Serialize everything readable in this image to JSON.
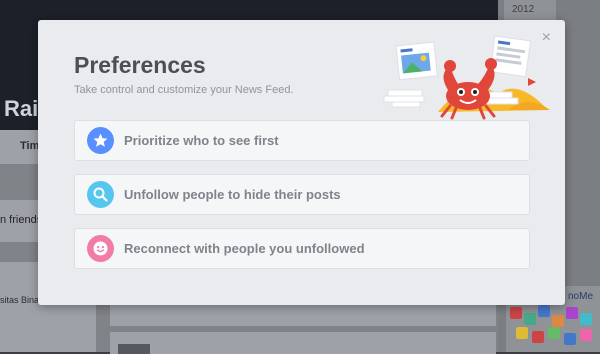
{
  "background": {
    "profile_name": "Rais",
    "tab_label": "Tim",
    "friends_text": "n friends",
    "university_text": "sitas Bina",
    "year_label": "2012",
    "ad_title": "noMe"
  },
  "modal": {
    "title": "Preferences",
    "subtitle": "Take control and customize your News Feed.",
    "close_label": "×",
    "options": [
      {
        "label": "Prioritize who to see first",
        "icon": "star-icon",
        "color": "#5890ff"
      },
      {
        "label": "Unfollow people to hide their posts",
        "icon": "search-icon",
        "color": "#55c6ee"
      },
      {
        "label": "Reconnect with people you unfollowed",
        "icon": "smiley-icon",
        "color": "#f27ba7"
      }
    ]
  },
  "colors": {
    "overlay": "#3a3d44",
    "modal_bg": "#e9ebee",
    "text_title": "#4b4f56",
    "text_muted": "#90949c"
  }
}
